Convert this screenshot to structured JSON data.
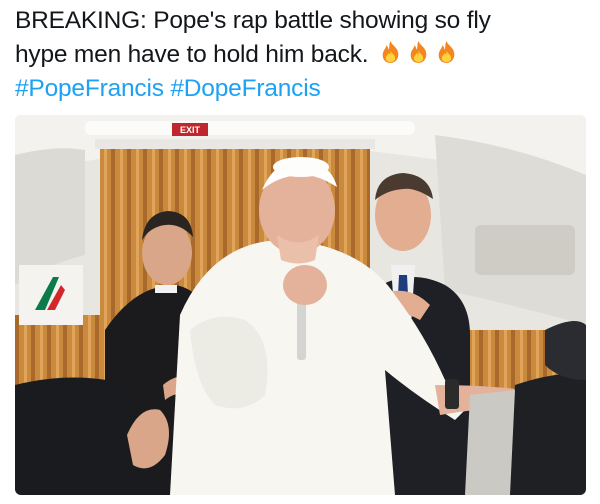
{
  "tweet": {
    "line1": "BREAKING: Pope's rap battle showing so fly",
    "line2": "hype men have to hold him back.",
    "hashtag1": "#PopeFrancis",
    "hashtag2": "#DopeFrancis",
    "emoji": [
      "fire-emoji",
      "fire-emoji",
      "fire-emoji"
    ]
  },
  "photo": {
    "exit_sign": "EXIT"
  },
  "colors": {
    "text": "#14171a",
    "hashtag": "#1da1f2",
    "flame_outer": "#f2861f",
    "flame_inner": "#fcd33a",
    "curtain": "#c98a3e",
    "cabin": "#e8e6e1"
  }
}
